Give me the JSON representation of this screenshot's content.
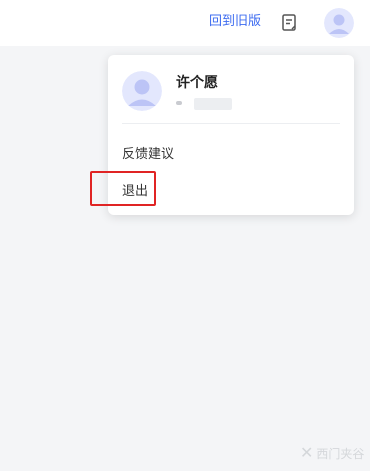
{
  "header": {
    "old_version_link": "回到旧版",
    "doc_icon": "document-edit-icon",
    "avatar_icon": "user-avatar-icon"
  },
  "user_menu": {
    "name": "许个愿",
    "items": [
      "反馈建议",
      "退出"
    ]
  },
  "watermark": {
    "mark": "✕",
    "text": "西门夹谷"
  },
  "colors": {
    "link": "#3e6cf0",
    "highlight": "#e02424",
    "avatar": "#bcc4f6"
  }
}
